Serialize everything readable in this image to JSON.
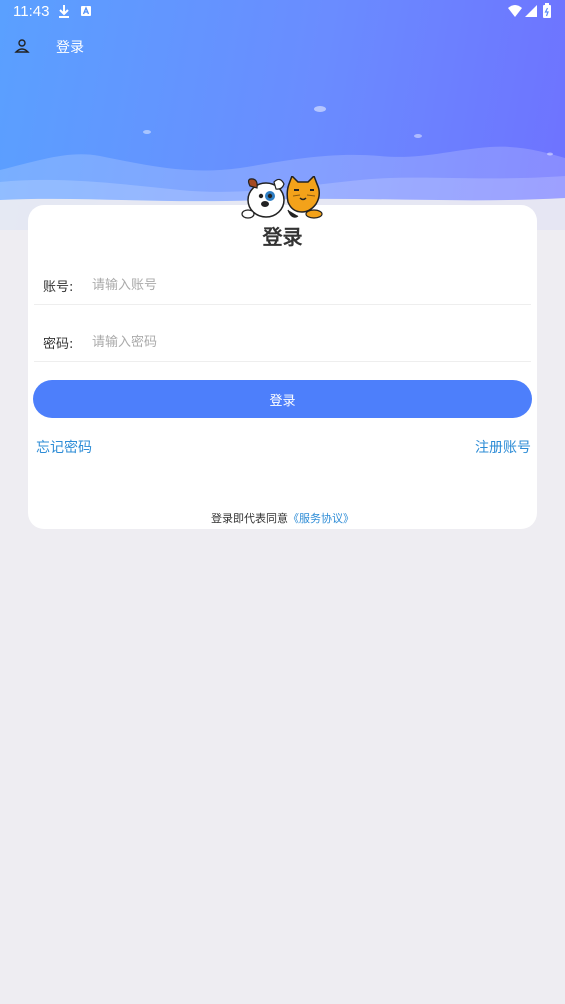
{
  "status_bar": {
    "time": "11:43"
  },
  "header": {
    "title": "登录"
  },
  "card": {
    "title": "登录",
    "account": {
      "label": "账号:",
      "placeholder": "请输入账号",
      "value": ""
    },
    "password": {
      "label": "密码:",
      "placeholder": "请输入密码",
      "value": ""
    },
    "login_button": "登录",
    "forgot_link": "忘记密码",
    "register_link": "注册账号",
    "agreement_prefix": "登录即代表同意",
    "agreement_link": "《服务协议》"
  },
  "colors": {
    "accent": "#4d7ffb",
    "link": "#2d8cd6",
    "background": "#eeedf2"
  }
}
